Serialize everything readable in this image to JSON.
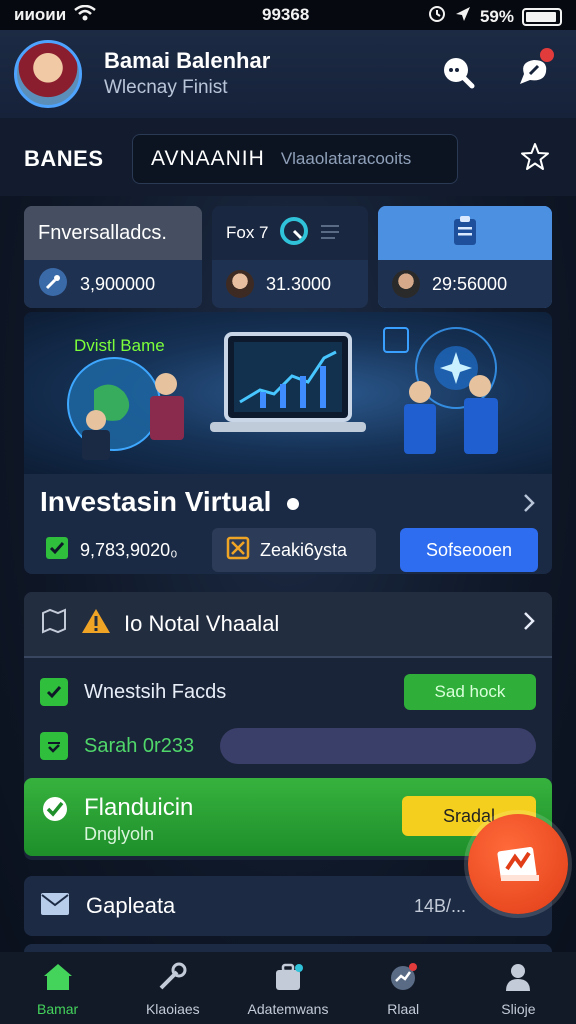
{
  "status_bar": {
    "carrier": "ᴎᴎᴏᴎᴎ",
    "time": "99368",
    "battery_text": "59%"
  },
  "header": {
    "name": "Bamai Balenhar",
    "subtitle": "Wlecnay Finist"
  },
  "tabs": {
    "label": "BANES",
    "search_keyword": "AVNAANIH",
    "search_placeholder": "Vlaaolataracooits"
  },
  "cards": [
    {
      "title": "Fnversalladcs.",
      "value": "3,900000"
    },
    {
      "title": "Fox 7",
      "value": "31.3000"
    },
    {
      "title": "",
      "value": "29:56000"
    }
  ],
  "banner": {
    "tag": "Dvistl Bame"
  },
  "invest": {
    "title": "Investasin Virtual",
    "amount": "9,783,9020₀",
    "secondary": "Zeaki6ysta",
    "action": "Sofseooen"
  },
  "panel": {
    "heading": "Io Notal Vhaalal",
    "rows": [
      {
        "label": "Wnestsih Facds",
        "button": "Sad hock"
      },
      {
        "label": "Sarah 0r233"
      }
    ],
    "highlight": {
      "title": "Flanduicin",
      "subtitle": "Dnglyoln",
      "button": "Sradal"
    }
  },
  "mail": {
    "label": "Gapleata",
    "value": "14B/..."
  },
  "bottom_nav": [
    {
      "label": "Bamar",
      "icon": "home-icon",
      "active": true
    },
    {
      "label": "Klaoiaes",
      "icon": "tools-icon",
      "active": false
    },
    {
      "label": "Adatemwans",
      "icon": "briefcase-icon",
      "active": false
    },
    {
      "label": "Rlaal",
      "icon": "chart-icon",
      "active": false
    },
    {
      "label": "Slioje",
      "icon": "profile-icon",
      "active": false
    }
  ],
  "colors": {
    "accent_green": "#2fbf3c",
    "accent_blue": "#2e6cf0",
    "fab_orange": "#e13d17"
  }
}
